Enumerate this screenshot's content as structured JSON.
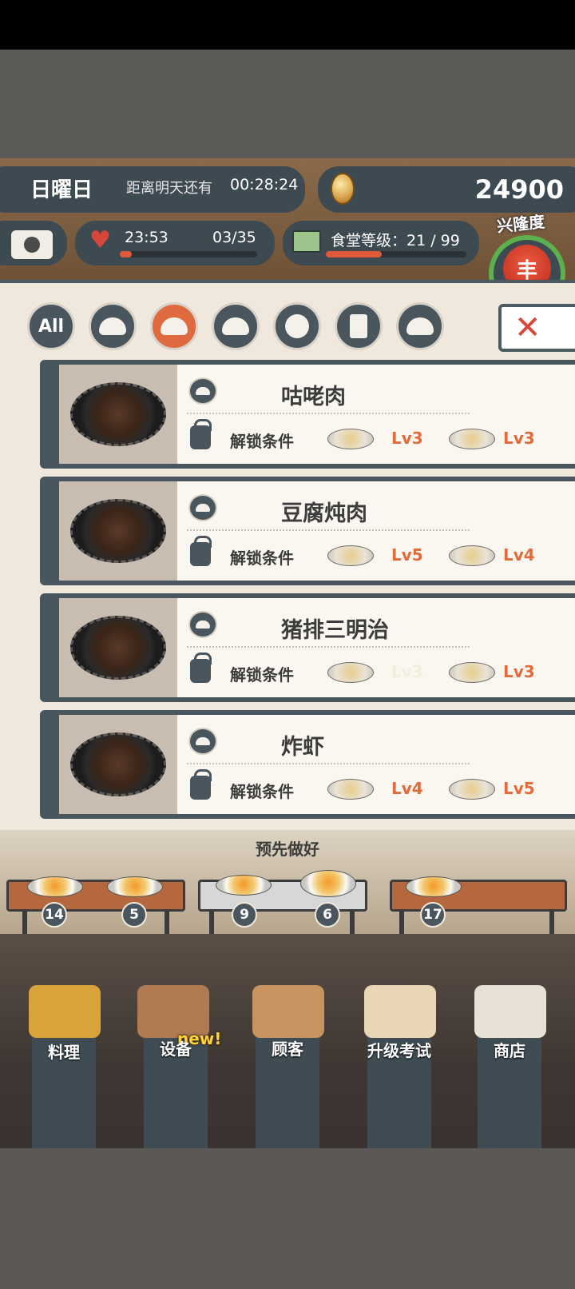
{
  "hud": {
    "day": "日曜日",
    "countdown_label": "距离明天还有",
    "countdown_time": "00:28:24",
    "coins": "24900",
    "stamina_time": "23:53",
    "stamina_count": "03/35",
    "stamina_progress": 0.086,
    "cafeteria_level": "食堂等级：21 / 99",
    "level_progress": 0.4,
    "prosperity_label": "兴隆度",
    "prosperity_glyph": "丰"
  },
  "filters": {
    "all_label": "All",
    "items": [
      "all",
      "rice",
      "main-dish",
      "side-dish",
      "noodle",
      "drink",
      "dessert"
    ],
    "active": "main-dish"
  },
  "close_glyph": "✕",
  "recipes": [
    {
      "name": "咕咾肉",
      "unlock_label": "解锁条件",
      "req1_lv": "Lv3",
      "req2_lv": "Lv3"
    },
    {
      "name": "豆腐炖肉",
      "unlock_label": "解锁条件",
      "req1_lv": "Lv5",
      "req2_lv": "Lv4"
    },
    {
      "name": "猪排三明治",
      "unlock_label": "解锁条件",
      "req1_lv": "Lv3",
      "req2_lv": "Lv3"
    },
    {
      "name": "炸虾",
      "unlock_label": "解锁条件",
      "req1_lv": "Lv4",
      "req2_lv": "Lv5"
    }
  ],
  "prepared": {
    "title": "预先做好",
    "counts": [
      "14",
      "5",
      "9",
      "6",
      "17"
    ]
  },
  "nav": {
    "cook": "料理",
    "equipment": "设备",
    "equipment_badge": "new!",
    "customers": "顾客",
    "exam": "升级考试",
    "shop": "商店"
  },
  "colors": {
    "accent": "#e36a3a",
    "panel": "#f0e8dc",
    "dark_slate": "#4a565e",
    "prosperity_ring": "#5db14d"
  }
}
